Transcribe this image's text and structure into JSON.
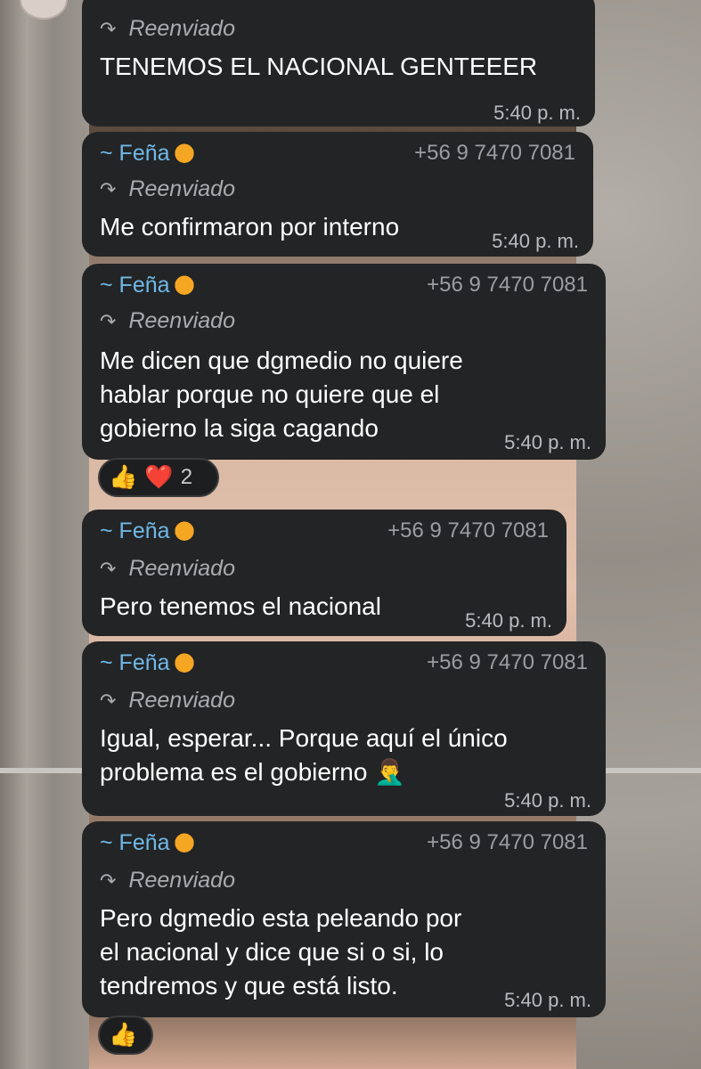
{
  "messages": [
    {
      "sender": "",
      "phone": "",
      "forwarded": "Reenviado",
      "lines": [
        "TENEMOS EL NACIONAL GENTEEER"
      ],
      "time": "5:40 p. m."
    },
    {
      "sender": "~ Feña",
      "phone": "+56 9 7470 7081",
      "forwarded": "Reenviado",
      "lines": [
        "Me confirmaron por interno"
      ],
      "time": "5:40 p. m."
    },
    {
      "sender": "~ Feña",
      "phone": "+56 9 7470 7081",
      "forwarded": "Reenviado",
      "lines": [
        "Me dicen que dgmedio no quiere",
        "hablar porque no quiere que el",
        "gobierno la siga cagando"
      ],
      "time": "5:40 p. m.",
      "reactions": {
        "emojis": [
          "👍",
          "❤️"
        ],
        "count": "2"
      }
    },
    {
      "sender": "~ Feña",
      "phone": "+56 9 7470 7081",
      "forwarded": "Reenviado",
      "lines": [
        "Pero tenemos el nacional"
      ],
      "time": "5:40 p. m."
    },
    {
      "sender": "~ Feña",
      "phone": "+56 9 7470 7081",
      "forwarded": "Reenviado",
      "lines": [
        "Igual, esperar... Porque aquí el único",
        "problema es el gobierno 🤦‍♂️"
      ],
      "time": "5:40 p. m."
    },
    {
      "sender": "~ Feña",
      "phone": "+56 9 7470 7081",
      "forwarded": "Reenviado",
      "lines": [
        "Pero dgmedio esta peleando por",
        "el nacional y dice que si o si, lo",
        "tendremos y que está listo."
      ],
      "time": "5:40 p. m.",
      "reactions": {
        "emojis": [
          "👍"
        ],
        "count": ""
      }
    }
  ],
  "icons": {
    "forward": "forward-arrow-icon",
    "sender_emoji": "tiger-face-icon"
  },
  "colors": {
    "bubble": "#232425",
    "sender": "#6fb8e8",
    "meta": "#9a9ea2"
  }
}
